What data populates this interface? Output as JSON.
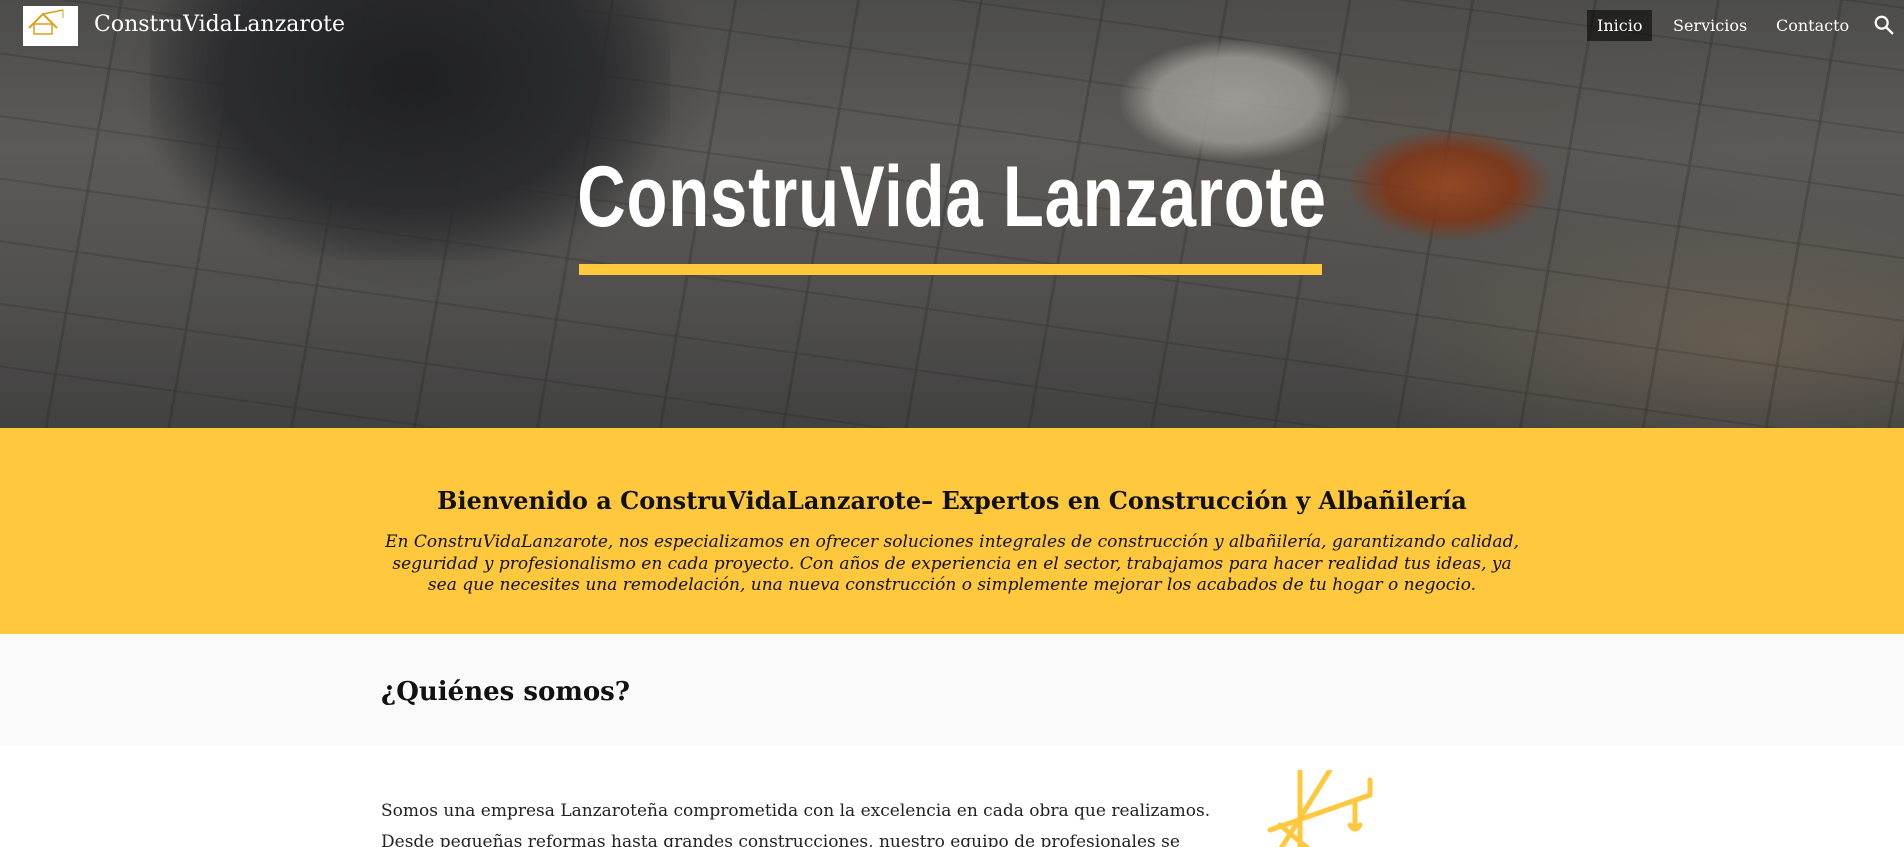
{
  "nav": {
    "brand": "ConstruVidaLanzarote",
    "logo_text": "ConstruVida",
    "items": [
      {
        "label": "Inicio",
        "active": true
      },
      {
        "label": "Servicios",
        "active": false
      },
      {
        "label": "Contacto",
        "active": false
      }
    ],
    "search_icon": "search-icon"
  },
  "hero": {
    "title": "ConstruVida Lanzarote",
    "accent_color": "#ffc83d"
  },
  "welcome": {
    "title": "Bienvenido a ConstruVidaLanzarote– Expertos en Construcción y Albañilería",
    "text": "En ConstruVidaLanzarote, nos especializamos en ofrecer soluciones integrales de construcción y albañilería, garantizando calidad, seguridad y profesionalismo en cada proyecto. Con años de experiencia en el sector, trabajamos para hacer realidad tus ideas, ya sea que necesites una remodelación, una nueva construcción o simplemente mejorar los acabados de tu hogar o negocio.",
    "background_color": "#ffc83d"
  },
  "about": {
    "title": "¿Quiénes somos?",
    "text": "Somos una empresa Lanzaroteña comprometida con la excelencia en cada obra que realizamos. Desde pequeñas reformas hasta grandes construcciones, nuestro equipo de profesionales se encarga de cada"
  }
}
